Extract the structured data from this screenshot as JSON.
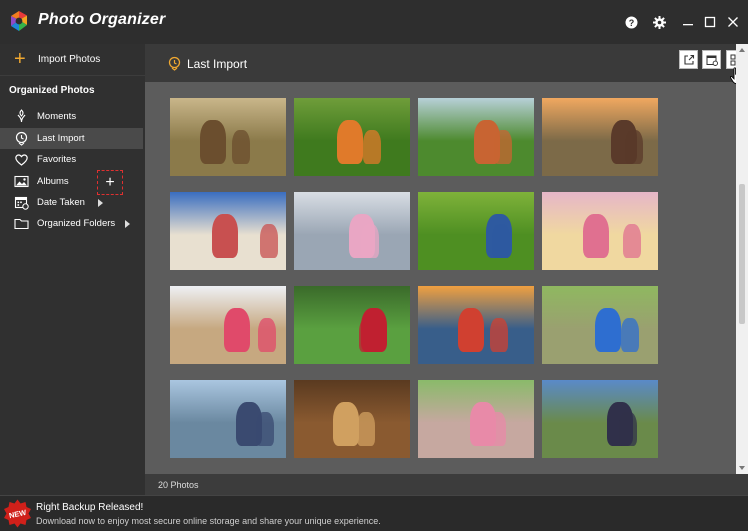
{
  "app": {
    "title": "Photo Organizer",
    "buttons": {
      "help": "?",
      "settings": "gear",
      "minimize": "minimize",
      "maximize": "maximize",
      "close": "close"
    }
  },
  "sidebar": {
    "import_label": "Import Photos",
    "section_title": "Organized Photos",
    "items": [
      {
        "label": "Moments",
        "icon": "moments-icon",
        "active": false
      },
      {
        "label": "Last Import",
        "icon": "last-import-icon",
        "active": true
      },
      {
        "label": "Favorites",
        "icon": "heart-icon",
        "active": false
      },
      {
        "label": "Albums",
        "icon": "albums-icon",
        "active": false
      },
      {
        "label": "Date Taken",
        "icon": "calendar-icon",
        "active": false,
        "has_arrow": true
      },
      {
        "label": "Organized Folders",
        "icon": "folder-icon",
        "active": false,
        "has_arrow": true
      }
    ],
    "add_album_label": "+"
  },
  "main": {
    "header_title": "Last Import",
    "view_buttons": [
      "open-external-icon",
      "calendar-view-icon",
      "grid-view-icon"
    ],
    "photos": [
      {
        "sky": "#c9b68a",
        "ground": "#8b7a4a",
        "fig": "#6b4e2e"
      },
      {
        "sky": "#6f9d3a",
        "ground": "#3f7a1e",
        "fig": "#e07a2a"
      },
      {
        "sky": "#b7d0d8",
        "ground": "#4d8a2e",
        "fig": "#c86432"
      },
      {
        "sky": "#f0a860",
        "ground": "#7c6a48",
        "fig": "#5a3a2a"
      },
      {
        "sky": "#3a6ec0",
        "ground": "#e8e0d0",
        "fig": "#c85050"
      },
      {
        "sky": "#d8dde4",
        "ground": "#9aa6b4",
        "fig": "#e9a6c4"
      },
      {
        "sky": "#7fb23a",
        "ground": "#4e8f22",
        "fig": "#2e5aa0"
      },
      {
        "sky": "#e6b6c8",
        "ground": "#f0d8a0",
        "fig": "#e07090"
      },
      {
        "sky": "#eef0f4",
        "ground": "#c6a880",
        "fig": "#e04a6a"
      },
      {
        "sky": "#3a6a2a",
        "ground": "#5aa040",
        "fig": "#c02030"
      },
      {
        "sky": "#f0a040",
        "ground": "#385e8a",
        "fig": "#d04030"
      },
      {
        "sky": "#8fb860",
        "ground": "#9aa070",
        "fig": "#2e6ed0"
      },
      {
        "sky": "#aac6e0",
        "ground": "#6a88a0",
        "fig": "#3a4a70"
      },
      {
        "sky": "#5a3a20",
        "ground": "#8a5a30",
        "fig": "#d0a060"
      },
      {
        "sky": "#8aba6a",
        "ground": "#c6a8a0",
        "fig": "#e88aa8"
      },
      {
        "sky": "#5a8ac8",
        "ground": "#6a8a4a",
        "fig": "#30304a"
      },
      {
        "sky": "#a8a8a8",
        "ground": "#8a8a8a",
        "fig": "#6a6a6a"
      },
      {
        "sky": "#6aa0d0",
        "ground": "#4a7aa0",
        "fig": "#3a5a80"
      },
      {
        "sky": "#c8c0b0",
        "ground": "#a09080",
        "fig": "#7a6a5a"
      },
      {
        "sky": "#e0e0e0",
        "ground": "#c0c0c0",
        "fig": "#909090"
      }
    ]
  },
  "status": {
    "photo_count": "20 Photos"
  },
  "footer": {
    "badge": "NEW",
    "title": "Right Backup Released!",
    "subtitle": "Download now to enjoy most secure online storage and share your unique experience."
  },
  "colors": {
    "accent": "#f0a830",
    "badge": "#d0201a"
  }
}
